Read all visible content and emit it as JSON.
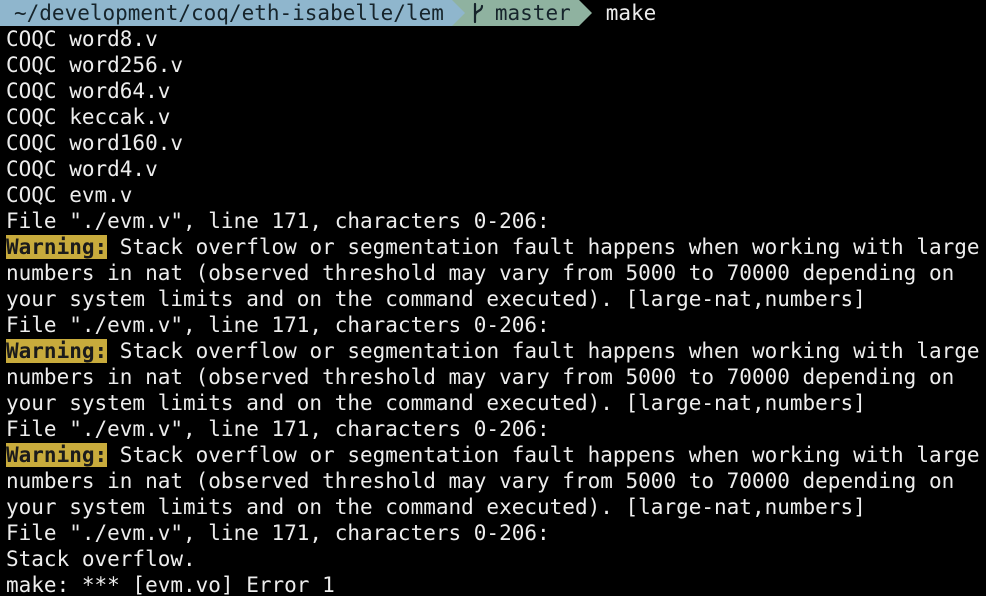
{
  "prompt": {
    "path": "~/development/coq/eth-isabelle/lem",
    "branch": "master",
    "command": "make",
    "branch_icon": "git-branch-icon"
  },
  "output": [
    "COQC word8.v",
    "COQC word256.v",
    "COQC word64.v",
    "COQC keccak.v",
    "COQC word160.v",
    "COQC word4.v",
    "COQC evm.v",
    "File \"./evm.v\", line 171, characters 0-206:",
    {
      "tag": "Warning:",
      "text": " Stack overflow or segmentation fault happens when working with large"
    },
    "numbers in nat (observed threshold may vary from 5000 to 70000 depending on",
    "your system limits and on the command executed). [large-nat,numbers]",
    "File \"./evm.v\", line 171, characters 0-206:",
    {
      "tag": "Warning:",
      "text": " Stack overflow or segmentation fault happens when working with large"
    },
    "numbers in nat (observed threshold may vary from 5000 to 70000 depending on",
    "your system limits and on the command executed). [large-nat,numbers]",
    "File \"./evm.v\", line 171, characters 0-206:",
    {
      "tag": "Warning:",
      "text": " Stack overflow or segmentation fault happens when working with large"
    },
    "numbers in nat (observed threshold may vary from 5000 to 70000 depending on",
    "your system limits and on the command executed). [large-nat,numbers]",
    "File \"./evm.v\", line 171, characters 0-206:",
    "Stack overflow.",
    "make: *** [evm.vo] Error 1"
  ],
  "colors": {
    "background": "#000000",
    "foreground": "#ededed",
    "path_segment": "#8fb6cd",
    "git_segment": "#8fb2a0",
    "warning_highlight": "#c8ab3c"
  }
}
